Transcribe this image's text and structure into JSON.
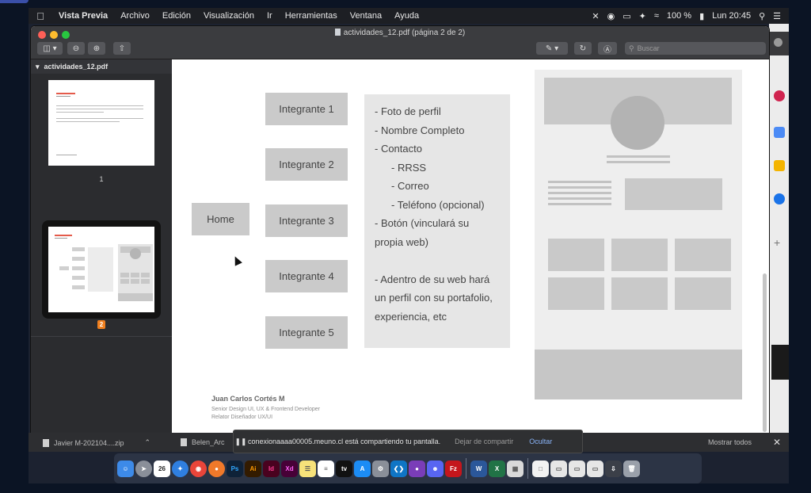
{
  "menubar": {
    "app_name": "Vista Previa",
    "items": [
      "Archivo",
      "Edición",
      "Visualización",
      "Ir",
      "Herramientas",
      "Ventana",
      "Ayuda"
    ],
    "battery": "100 %",
    "clock": "Lun 20:45"
  },
  "window": {
    "title": "actividades_12.pdf (página 2 de 2)",
    "search_placeholder": "Buscar"
  },
  "sidebar": {
    "file_name": "actividades_12.pdf",
    "thumbs": [
      {
        "label": "1"
      },
      {
        "label": "2"
      }
    ]
  },
  "page": {
    "home_label": "Home",
    "members": [
      "Integrante 1",
      "Integrante 2",
      "Integrante 3",
      "Integrante 4",
      "Integrante 5"
    ],
    "info_lines": [
      "- Foto de perfil",
      "- Nombre Completo",
      "- Contacto",
      "- RRSS",
      "- Correo",
      "- Teléfono (opcional)",
      "- Botón (vinculará su",
      "propia web)",
      "",
      "- Adentro de su web hará",
      "un perfil con su portafolio,",
      "experiencia, etc"
    ],
    "author": {
      "name": "Juan Carlos Cortés M",
      "role1": "Senior Design UI, UX & Frontend Developer",
      "role2": "Relator Diseñador UX/UI"
    }
  },
  "downloads": {
    "item1": "Javier M-202104....zip",
    "item2": "Belen_Arc",
    "show_all": "Mostrar todos"
  },
  "share_banner": {
    "message": "conexionaaaa00005.meuno.cl está compartiendo tu pantalla.",
    "stop": "Dejar de compartir",
    "hide": "Ocultar"
  },
  "dock": {
    "calendar_day": "26",
    "icons": [
      "finder-icon",
      "launchpad-icon",
      "calendar-icon",
      "safari-icon",
      "chrome-icon",
      "firefox-icon",
      "photoshop-icon",
      "illustrator-icon",
      "indesign-icon",
      "xd-icon",
      "notes-icon",
      "reminders-icon",
      "appletv-icon",
      "appstore-icon",
      "system-preferences-icon",
      "vscode-icon",
      "github-icon",
      "discord-icon",
      "filezilla-icon",
      "word-icon",
      "excel-icon",
      "preview-icon",
      "document-icon",
      "downloads-icon",
      "trash-icon"
    ]
  }
}
